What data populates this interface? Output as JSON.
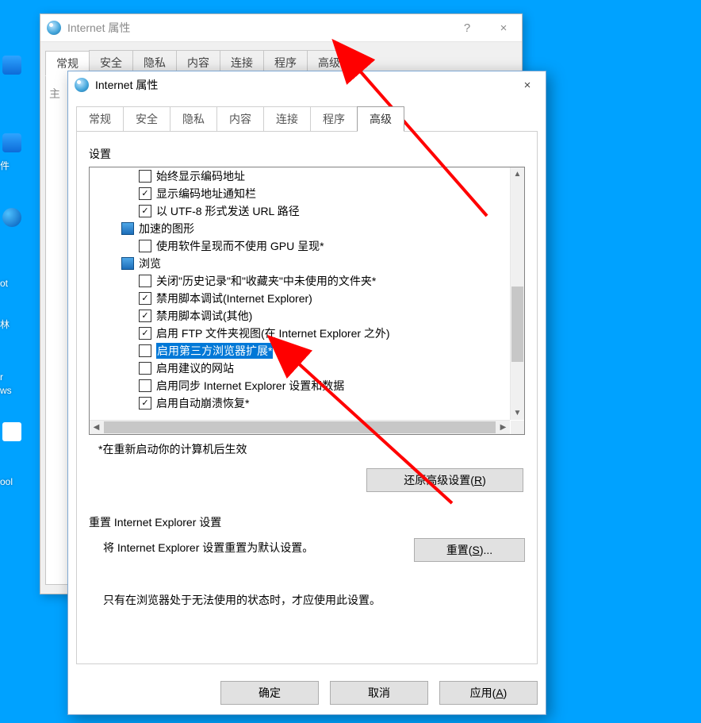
{
  "back_window": {
    "title": "Internet 属性",
    "help": "?",
    "close": "×",
    "tabs": [
      "常规",
      "安全",
      "隐私",
      "内容",
      "连接",
      "程序",
      "高级"
    ]
  },
  "front_window": {
    "title": "Internet 属性",
    "close": "×",
    "tabs": [
      "常规",
      "安全",
      "隐私",
      "内容",
      "连接",
      "程序",
      "高级"
    ],
    "active_tab_index": 6,
    "settings_label": "设置",
    "tree": [
      {
        "type": "item",
        "level": 2,
        "checked": false,
        "label": "始终显示编码地址"
      },
      {
        "type": "item",
        "level": 2,
        "checked": true,
        "label": "显示编码地址通知栏"
      },
      {
        "type": "item",
        "level": 2,
        "checked": true,
        "label": "以 UTF-8 形式发送 URL 路径"
      },
      {
        "type": "cat",
        "level": 1,
        "label": "加速的图形"
      },
      {
        "type": "item",
        "level": 2,
        "checked": false,
        "label": "使用软件呈现而不使用 GPU 呈现*"
      },
      {
        "type": "cat",
        "level": 1,
        "label": "浏览"
      },
      {
        "type": "item",
        "level": 2,
        "checked": false,
        "label": "关闭\"历史记录\"和\"收藏夹\"中未使用的文件夹*"
      },
      {
        "type": "item",
        "level": 2,
        "checked": true,
        "label": "禁用脚本调试(Internet Explorer)"
      },
      {
        "type": "item",
        "level": 2,
        "checked": true,
        "label": "禁用脚本调试(其他)"
      },
      {
        "type": "item",
        "level": 2,
        "checked": true,
        "label": "启用 FTP 文件夹视图(在 Internet Explorer 之外)"
      },
      {
        "type": "item",
        "level": 2,
        "checked": false,
        "label": "启用第三方浏览器扩展*",
        "selected": true
      },
      {
        "type": "item",
        "level": 2,
        "checked": false,
        "label": "启用建议的网站"
      },
      {
        "type": "item",
        "level": 2,
        "checked": false,
        "label": "启用同步 Internet Explorer 设置和数据"
      },
      {
        "type": "item",
        "level": 2,
        "checked": true,
        "label": "启用自动崩溃恢复*"
      }
    ],
    "restart_note": "*在重新启动你的计算机后生效",
    "restore_btn": "还原高级设置(R)",
    "reset_section_title": "重置 Internet Explorer 设置",
    "reset_desc": "将 Internet Explorer 设置重置为默认设置。",
    "reset_btn": "重置(S)...",
    "reset_note": "只有在浏览器处于无法使用的状态时，才应使用此设置。",
    "buttons": {
      "ok": "确定",
      "cancel": "取消",
      "apply": "应用(A)"
    }
  },
  "desktop": {
    "f1": "件",
    "f2": "ot",
    "f3": "林",
    "f4": "r",
    "f5": "ws",
    "f6": "ool"
  }
}
